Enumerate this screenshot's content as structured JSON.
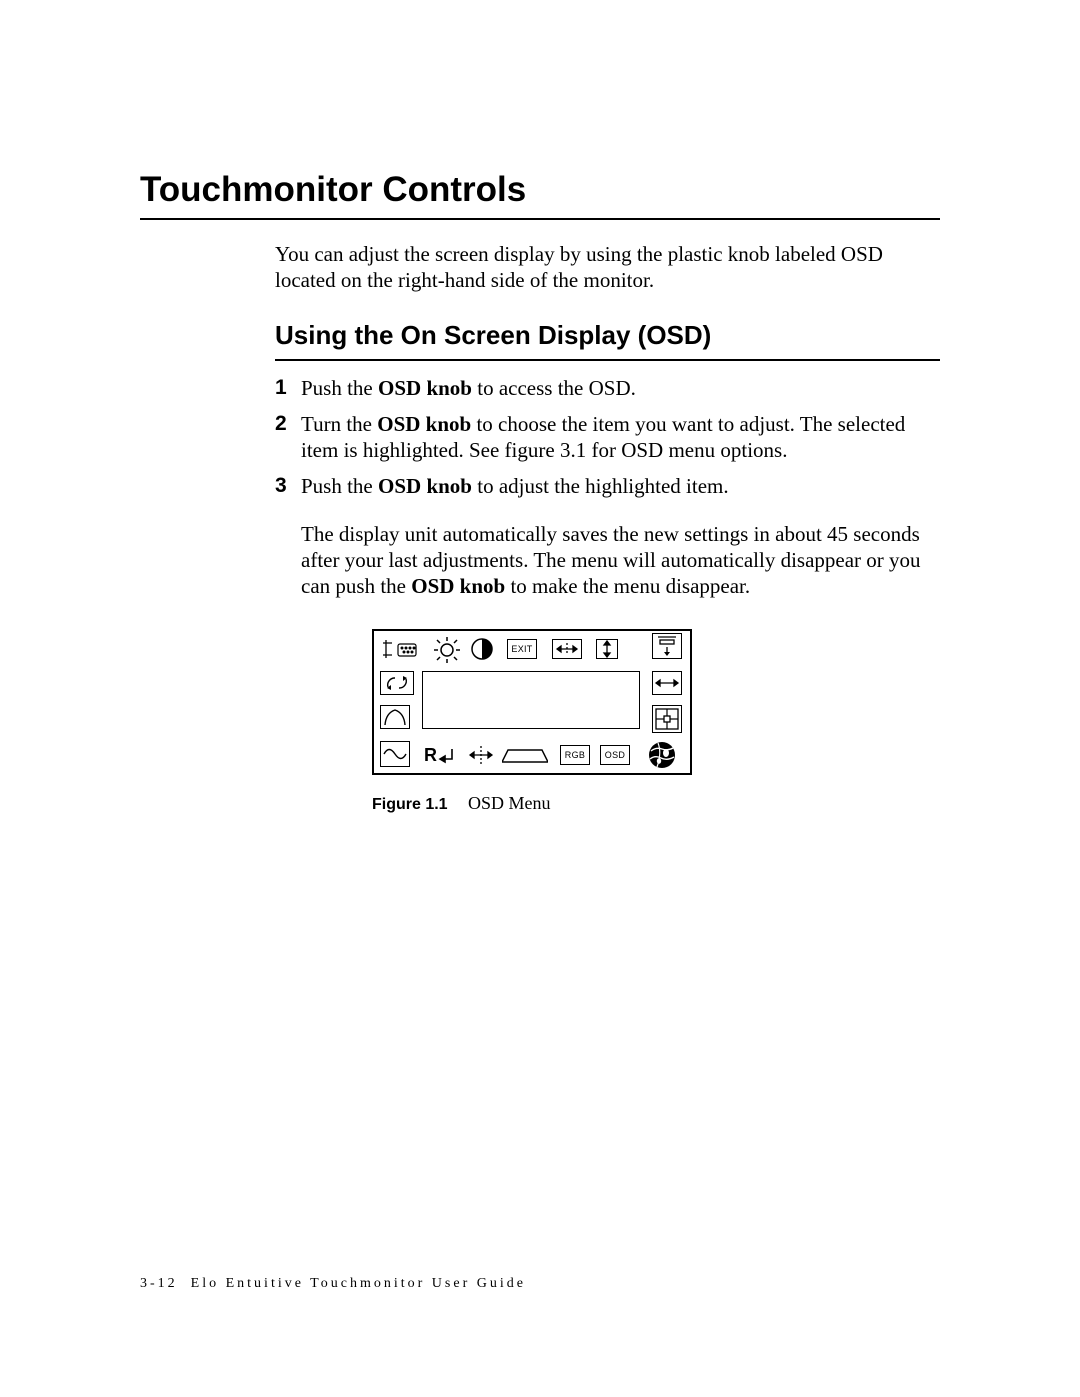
{
  "section_title": "Touchmonitor Controls",
  "intro": "You can adjust the screen display by using the plastic knob labeled OSD located on the right-hand side of the monitor.",
  "subhead": "Using the On Screen Display (OSD)",
  "steps": {
    "s1": {
      "pre": "Push the ",
      "bold": "OSD knob",
      "post": " to access the OSD."
    },
    "s2": {
      "pre": "Turn the ",
      "bold": "OSD knob",
      "post": " to choose the item you want to adjust. The selected item is highlighted. See figure 3.1 for OSD menu options."
    },
    "s3": {
      "pre": "Push the ",
      "bold": "OSD knob",
      "post": " to adjust the highlighted item."
    }
  },
  "after": {
    "pre": "The display unit automatically saves the new settings in about 45 seconds after your last adjustments. The menu will automatically disappear or you can push the ",
    "bold": "OSD knob",
    "post": " to make the menu disappear."
  },
  "osd_labels": {
    "exit": "EXIT",
    "rgb": "RGB",
    "osd": "OSD",
    "r": "R"
  },
  "figure": {
    "label": "Figure 1.1",
    "caption": "OSD Menu"
  },
  "footer": {
    "page": "3-12",
    "title": "Elo Entuitive Touchmonitor User Guide"
  }
}
